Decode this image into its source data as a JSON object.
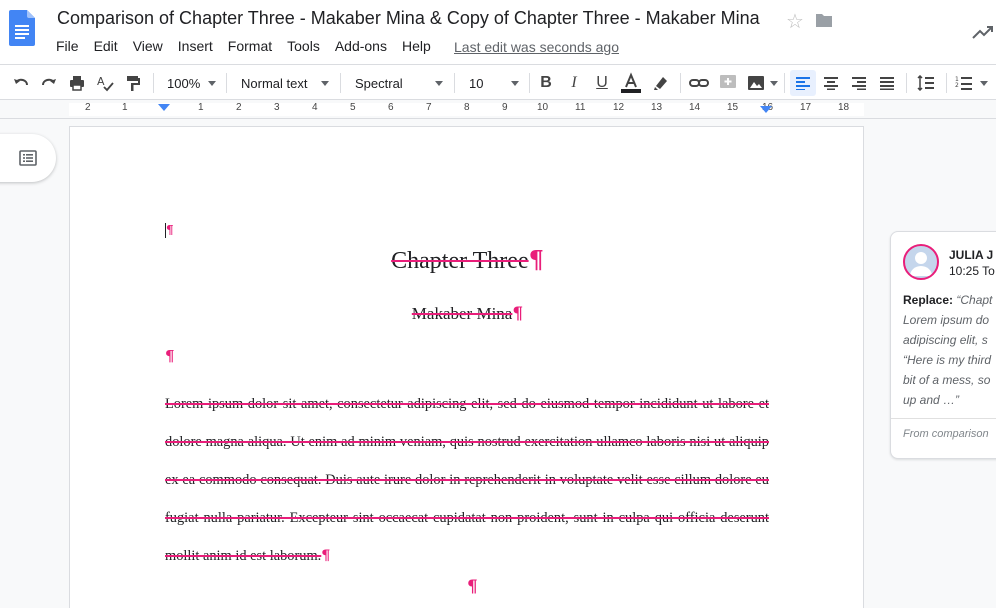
{
  "header": {
    "title": "Comparison of Chapter Three - Makaber Mina & Copy of Chapter Three - Makaber Mina",
    "last_edit": "Last edit was seconds ago"
  },
  "menu": [
    "File",
    "Edit",
    "View",
    "Insert",
    "Format",
    "Tools",
    "Add-ons",
    "Help"
  ],
  "toolbar": {
    "zoom": "100%",
    "style": "Normal text",
    "font": "Spectral",
    "size": "10"
  },
  "ruler": {
    "labels": [
      "2",
      "1",
      "1",
      "2",
      "3",
      "4",
      "5",
      "6",
      "7",
      "8",
      "9",
      "10",
      "11",
      "12",
      "13",
      "14",
      "15",
      "16",
      "17",
      "18"
    ]
  },
  "document": {
    "cursor_mark": "¶",
    "chapter_title": "Chapter Three",
    "author": "Makaber Mina",
    "empty_para": "¶",
    "body": "Lorem ipsum dolor sit amet, consectetur adipiscing elit, sed do eiusmod tempor incididunt ut labore et dolore magna aliqua. Ut enim ad minim veniam, quis nostrud exercitation ullamco laboris nisi ut aliquip ex ea commodo consequat. Duis aute irure dolor in reprehenderit in voluptate velit esse cillum dolore eu fugiat nulla pariatur. Excepteur sint occaecat cupidatat non proident, sunt in culpa qui officia deserunt mollit anim id est laborum.",
    "pilcrow": "¶",
    "center_para": "¶"
  },
  "comment": {
    "author": "JULIA J",
    "time": "10:25 To",
    "replace_label": "Replace:",
    "lines": [
      "“Chapt",
      "Lorem ipsum do",
      "adipiscing elit, s",
      "“Here is my third",
      "bit of a mess, so",
      "up and …”"
    ],
    "footer": "From comparison"
  },
  "colors": {
    "accent": "#e91e7a",
    "docs_blue": "#4285f4"
  }
}
